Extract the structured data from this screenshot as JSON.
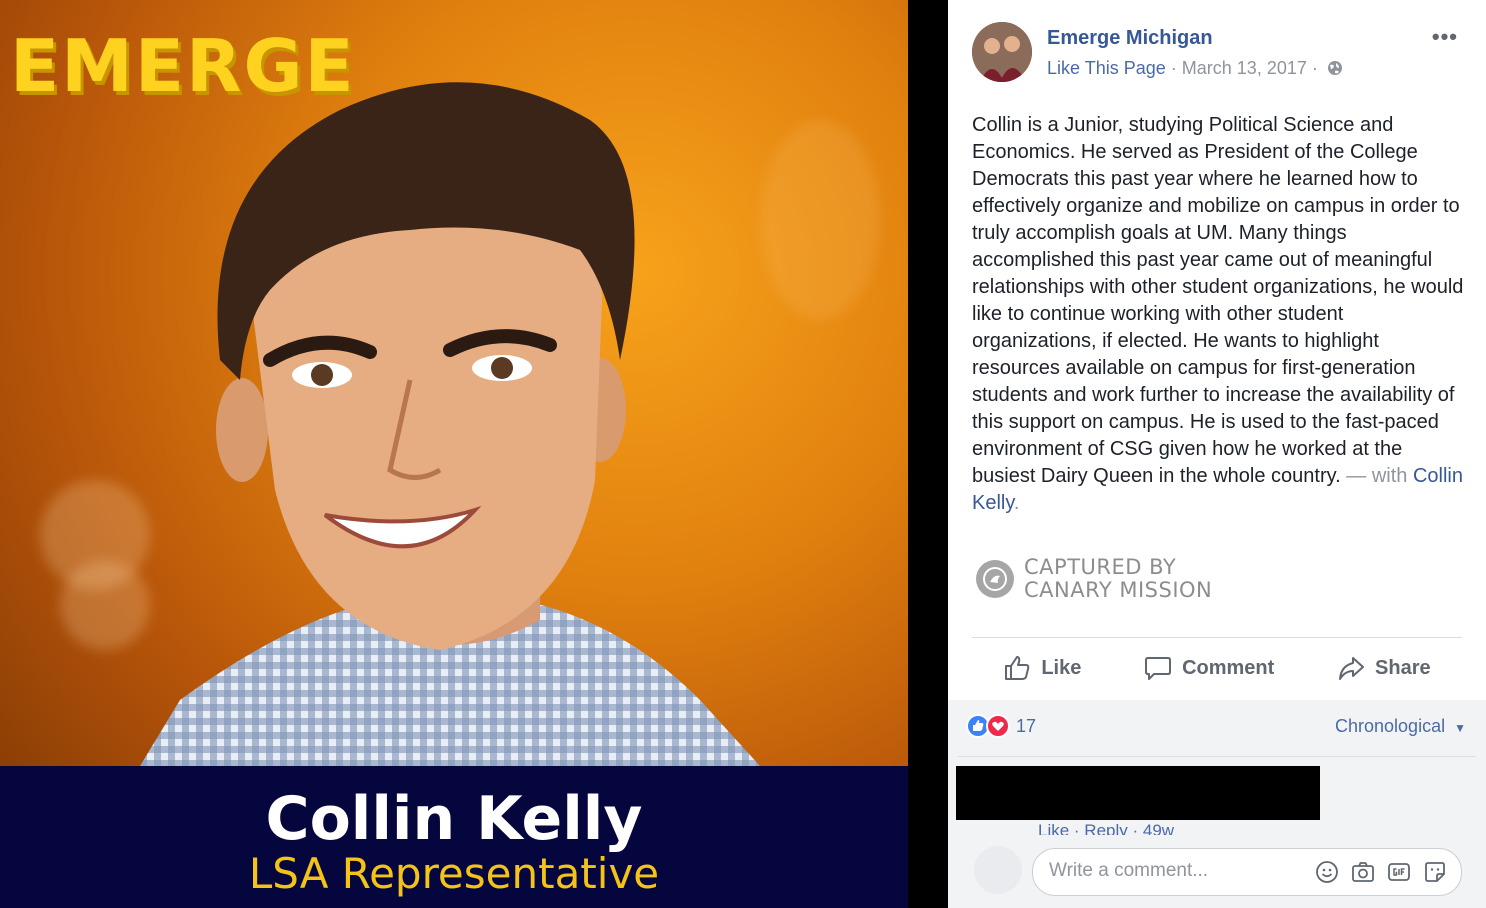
{
  "photo": {
    "logo_text": "EMERGE",
    "candidate_name": "Collin Kelly",
    "candidate_role": "LSA Representative"
  },
  "post": {
    "page_name": "Emerge Michigan",
    "like_page": "Like This Page",
    "date": "March 13, 2017",
    "separator": "·",
    "body": "Collin is a Junior, studying Political Science and Economics. He served as President of the College Democrats this past year where he learned how to effectively organize and mobilize on campus in order to truly accomplish goals at UM. Many things accomplished this past year came out of meaningful relationships with other student organizations, he would like to continue working with other student organizations, if elected. He wants to highlight resources available on campus for first-generation students and work further to increase the availability of this support on campus. He is used to the fast-paced environment of CSG given how he worked at the busiest Dairy Queen in the whole country.",
    "with_prefix": "— with",
    "tagged_name": "Collin Kelly",
    "tag_suffix": "."
  },
  "watermark": {
    "line1": "CAPTURED BY",
    "line2": "CANARY MISSION"
  },
  "actions": {
    "like": "Like",
    "comment": "Comment",
    "share": "Share"
  },
  "reactions": {
    "count": "17",
    "sort_label": "Chronological"
  },
  "comment": {
    "actions_text": "Like · Reply · 49w"
  },
  "composer": {
    "placeholder": "Write a comment..."
  },
  "colors": {
    "link_blue": "#365899",
    "name_bar": "#06063f",
    "logo_yellow": "#ffd21f",
    "role_yellow": "#f3c318"
  }
}
